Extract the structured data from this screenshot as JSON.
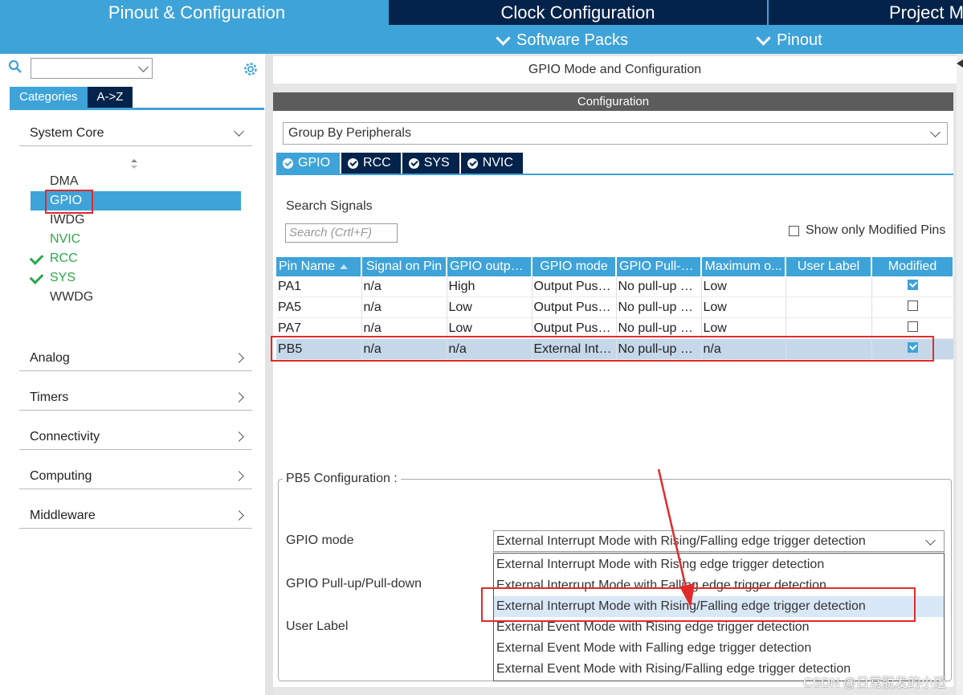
{
  "top_tabs": {
    "pinout": "Pinout & Configuration",
    "clock": "Clock Configuration",
    "project": "Project M"
  },
  "subnav": {
    "software_packs": "Software Packs",
    "pinout": "Pinout"
  },
  "left": {
    "search_value": "",
    "tabs": {
      "categories": "Categories",
      "az": "A->Z"
    },
    "categories": {
      "system_core": "System Core",
      "analog": "Analog",
      "timers": "Timers",
      "connectivity": "Connectivity",
      "computing": "Computing",
      "middleware": "Middleware"
    },
    "peripherals": [
      "DMA",
      "GPIO",
      "IWDG",
      "NVIC",
      "RCC",
      "SYS",
      "WWDG"
    ]
  },
  "right": {
    "title": "GPIO Mode and Configuration",
    "config_bar": "Configuration",
    "group_by": "Group By Peripherals",
    "periph_tabs": [
      "GPIO",
      "RCC",
      "SYS",
      "NVIC"
    ],
    "search_label": "Search Signals",
    "search_placeholder": "Search (Crtl+F)",
    "show_modified": "Show only Modified Pins",
    "table": {
      "headers": [
        "Pin Name",
        "Signal on Pin",
        "GPIO output...",
        "GPIO mode",
        "GPIO Pull-u...",
        "Maximum o...",
        "User Label",
        "Modified"
      ],
      "rows": [
        {
          "pin": "PA1",
          "signal": "n/a",
          "output": "High",
          "mode": "Output Push Pull",
          "pull": "No pull-up and no pull-down",
          "max": "Low",
          "label": "",
          "modified": true
        },
        {
          "pin": "PA5",
          "signal": "n/a",
          "output": "Low",
          "mode": "Output Push Pull",
          "pull": "No pull-up and no pull-down",
          "max": "Low",
          "label": "",
          "modified": false
        },
        {
          "pin": "PA7",
          "signal": "n/a",
          "output": "Low",
          "mode": "Output Push Pull",
          "pull": "No pull-up and no pull-down",
          "max": "Low",
          "label": "",
          "modified": false
        },
        {
          "pin": "PB5",
          "signal": "n/a",
          "output": "n/a",
          "mode": "External Interrupt",
          "pull": "No pull-up and no pull-down",
          "max": "n/a",
          "label": "",
          "modified": true
        }
      ]
    },
    "pb5_config": {
      "legend": "PB5 Configuration :",
      "gpio_mode_label": "GPIO mode",
      "gpio_pull_label": "GPIO Pull-up/Pull-down",
      "user_label_label": "User Label",
      "gpio_mode_value": "External Interrupt Mode with Rising/Falling edge trigger detection",
      "options": [
        "External Interrupt Mode with Rising edge trigger detection",
        "External Interrupt Mode with Falling edge trigger detection",
        "External Interrupt Mode with Rising/Falling edge trigger detection",
        "External Event Mode with Rising edge trigger detection",
        "External Event Mode with Falling edge trigger detection",
        "External Event Mode with Rising/Falling edge trigger detection"
      ]
    }
  },
  "watermark": "CSDN @日常脱发的小迈",
  "colors": {
    "accent": "#3ea3d8",
    "dark": "#03234b",
    "highlight": "#e02b2b",
    "green": "#2aa84a"
  }
}
